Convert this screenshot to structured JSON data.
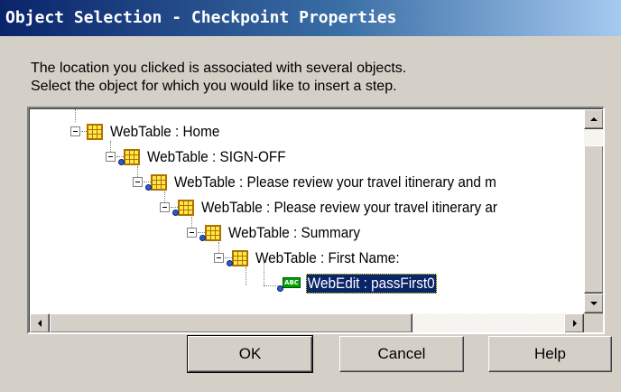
{
  "window": {
    "title": "Object Selection - Checkpoint Properties"
  },
  "message": {
    "line1": "The location you clicked is associated with several objects.",
    "line2": "Select the object for which you would like to insert a step."
  },
  "tree": {
    "nodes": [
      {
        "label": "WebTable : Home",
        "icon": "webtable-icon",
        "expanded": true
      },
      {
        "label": "WebTable : SIGN-OFF",
        "icon": "webtable-icon",
        "expanded": true
      },
      {
        "label": "WebTable : Please review your travel itinerary and m",
        "icon": "webtable-icon",
        "expanded": true
      },
      {
        "label": "WebTable : Please review your travel itinerary ar",
        "icon": "webtable-icon",
        "expanded": true
      },
      {
        "label": "WebTable : Summary",
        "icon": "webtable-icon",
        "expanded": true
      },
      {
        "label": "WebTable : First Name:",
        "icon": "webtable-icon",
        "expanded": true
      },
      {
        "label": "WebEdit : passFirst0",
        "icon": "webedit-icon",
        "selected": true
      }
    ],
    "edit_icon_text": "ABC"
  },
  "buttons": {
    "ok": "OK",
    "cancel": "Cancel",
    "help": "Help"
  },
  "colors": {
    "title_bar_start": "#0a246a",
    "title_bar_end": "#a6caf0",
    "selection": "#0a246a",
    "dialog_face": "#d4d0c8"
  }
}
